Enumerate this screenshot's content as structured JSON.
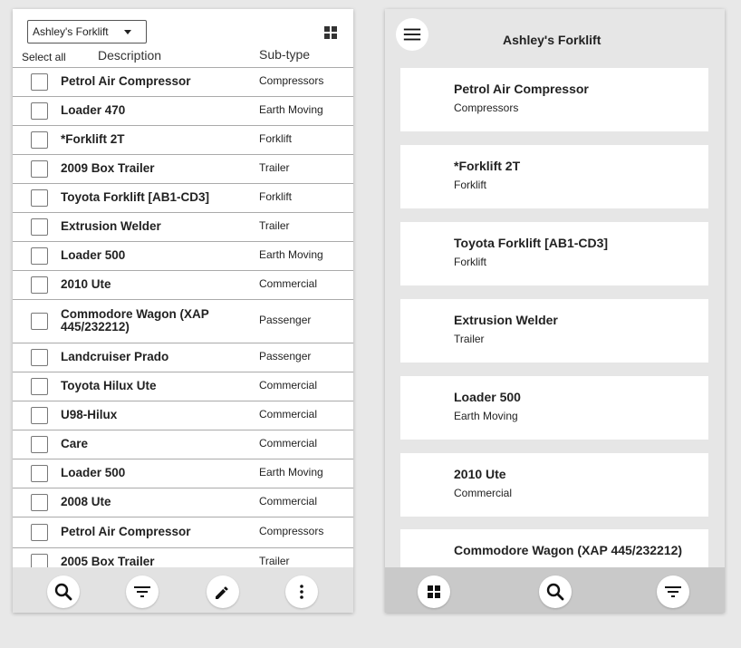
{
  "left": {
    "location_select": "Ashley's Forklift",
    "select_all": "Select all",
    "col_description": "Description",
    "col_subtype": "Sub-type",
    "rows": [
      {
        "description": "Petrol Air Compressor",
        "subtype": "Compressors"
      },
      {
        "description": "Loader 470",
        "subtype": "Earth Moving"
      },
      {
        "description": "*Forklift 2T",
        "subtype": "Forklift"
      },
      {
        "description": "2009 Box Trailer",
        "subtype": "Trailer"
      },
      {
        "description": "Toyota Forklift [AB1-CD3]",
        "subtype": "Forklift"
      },
      {
        "description": "Extrusion Welder",
        "subtype": "Trailer"
      },
      {
        "description": "Loader 500",
        "subtype": "Earth Moving"
      },
      {
        "description": "2010 Ute",
        "subtype": "Commercial"
      },
      {
        "description": "Commodore Wagon (XAP 445/232212)",
        "subtype": "Passenger"
      },
      {
        "description": "Landcruiser Prado",
        "subtype": "Passenger"
      },
      {
        "description": "Toyota Hilux Ute",
        "subtype": "Commercial"
      },
      {
        "description": "U98-Hilux",
        "subtype": "Commercial"
      },
      {
        "description": "Care",
        "subtype": "Commercial"
      },
      {
        "description": "Loader 500",
        "subtype": "Earth Moving"
      },
      {
        "description": "2008 Ute",
        "subtype": "Commercial"
      },
      {
        "description": "Petrol Air Compressor",
        "subtype": "Compressors"
      },
      {
        "description": "2005 Box Trailer",
        "subtype": "Trailer"
      }
    ],
    "toolbar_icons": [
      "search-icon",
      "filter-icon",
      "edit-icon",
      "more-vert-icon"
    ]
  },
  "right": {
    "title": "Ashley's Forklift",
    "cards": [
      {
        "title": "Petrol Air Compressor",
        "subtype": "Compressors"
      },
      {
        "title": "*Forklift 2T",
        "subtype": "Forklift"
      },
      {
        "title": "Toyota Forklift [AB1-CD3]",
        "subtype": "Forklift"
      },
      {
        "title": "Extrusion Welder",
        "subtype": "Trailer"
      },
      {
        "title": "Loader 500",
        "subtype": "Earth Moving"
      },
      {
        "title": "2010 Ute",
        "subtype": "Commercial"
      },
      {
        "title": "Commodore Wagon (XAP 445/232212)",
        "subtype": ""
      }
    ],
    "toolbar_icons": [
      "grid-icon",
      "search-icon",
      "filter-icon"
    ]
  }
}
